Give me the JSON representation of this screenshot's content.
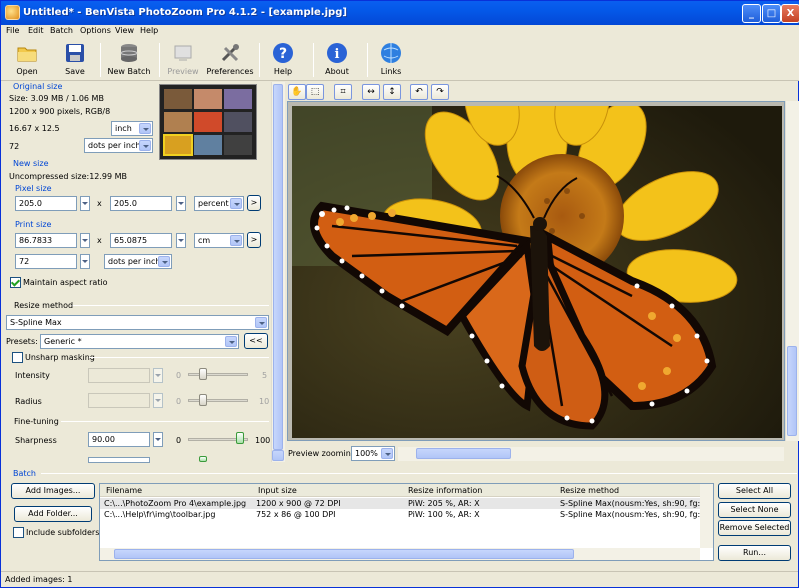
{
  "window": {
    "title": "Untitled* - BenVista PhotoZoom Pro 4.1.2 - [example.jpg]",
    "min": "_",
    "max": "□",
    "close": "X"
  },
  "menu": [
    "File",
    "Edit",
    "Batch",
    "Options",
    "View",
    "Help"
  ],
  "toolbar": {
    "open": "Open",
    "save": "Save",
    "new_batch": "New Batch",
    "preview": "Preview",
    "preferences": "Preferences",
    "help": "Help",
    "about": "About",
    "links": "Links"
  },
  "original": {
    "group": "Original size",
    "size": "Size: 3.09 MB / 1.06 MB",
    "pixels": "1200 x 900 pixels, RGB/8",
    "dims": "16.67 x 12.5",
    "unit": "inch",
    "dpi": "72",
    "dpi_unit": "dots per inch"
  },
  "newsize": {
    "group": "New size",
    "uncompressed": "Uncompressed size:12.99 MB",
    "pixel_group": "Pixel size",
    "px_w": "205.0",
    "x": "x",
    "px_h": "205.0",
    "px_unit": "percent",
    "go": ">",
    "print_group": "Print size",
    "pr_w": "86.7833",
    "pr_h": "65.0875",
    "pr_unit": "cm",
    "res": "72",
    "res_unit": "dots per inch",
    "maintain": "Maintain aspect ratio"
  },
  "resize": {
    "group": "Resize method",
    "method": "S-Spline Max",
    "presets_label": "Presets:",
    "preset": "Generic *",
    "preset_btn": "<<",
    "unsharp": "Unsharp masking",
    "intensity": "Intensity",
    "i_min": "0",
    "i_max": "5",
    "radius": "Radius",
    "r_min": "0",
    "r_max": "10",
    "fine": "Fine-tuning",
    "sharpness": "Sharpness",
    "sharp_val": "90.00",
    "s_min": "0",
    "s_max": "100"
  },
  "preview": {
    "zoom_label": "Preview zooming:",
    "zoom": "100%"
  },
  "batch": {
    "group": "Batch",
    "add_images": "Add Images...",
    "add_folder": "Add Folder...",
    "include_sub": "Include subfolders",
    "columns": [
      "Filename",
      "Input size",
      "Resize information",
      "Resize method"
    ],
    "rows": [
      [
        "C:\\...\\PhotoZoom Pro 4\\example.jpg",
        "1200 x 900 @ 72 DPI",
        "PiW: 205 %, AR: X",
        "S-Spline Max(nousm:Yes, sh:90, fg:2..."
      ],
      [
        "C:\\...\\Help\\fr\\img\\toolbar.jpg",
        "752 x 86 @ 100 DPI",
        "PiW: 100 %, AR: X",
        "S-Spline Max(nousm:Yes, sh:90, fg:2..."
      ]
    ],
    "select_all": "Select All",
    "select_none": "Select None",
    "remove": "Remove Selected",
    "run": "Run..."
  },
  "status": "Added images: 1"
}
